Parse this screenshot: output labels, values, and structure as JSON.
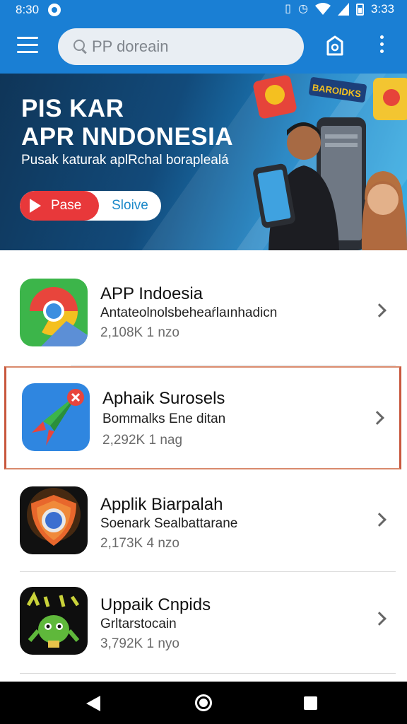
{
  "status_bar": {
    "time_left": "8:30",
    "time_right": "3:33",
    "icons": [
      "vibrate-icon",
      "alarm-icon",
      "wifi-icon",
      "signal-icon",
      "battery-icon"
    ]
  },
  "search": {
    "placeholder": "PP doreain"
  },
  "banner": {
    "title_line1": "PIS KAR",
    "title_line2": "APR NNDONESIA",
    "subtitle": "Pusak katurak aplRchal boraplealá",
    "primary_button": "Pase",
    "secondary_button": "Sloive",
    "badge": "BAROIDKS"
  },
  "apps": [
    {
      "name": "APP Indoesia",
      "desc": "Antateolnolsbeheaŕlaınhadicn",
      "meta": "2,108K 1 nzo"
    },
    {
      "name": "Aphaik Surosels",
      "desc": "Bommalks Ene ditan",
      "meta": "2,292K 1 nag"
    },
    {
      "name": "Applik Biarpalah",
      "desc": "Soenark Sealbattarane",
      "meta": "2,173K 4 nzo"
    },
    {
      "name": "Uppaik Cnpids",
      "desc": "Grltarstocain",
      "meta": "3,792K 1 nyo"
    }
  ],
  "colors": {
    "primary": "#1a7fd4",
    "accent_red": "#e8383a",
    "selected_border": "#c8573d"
  }
}
